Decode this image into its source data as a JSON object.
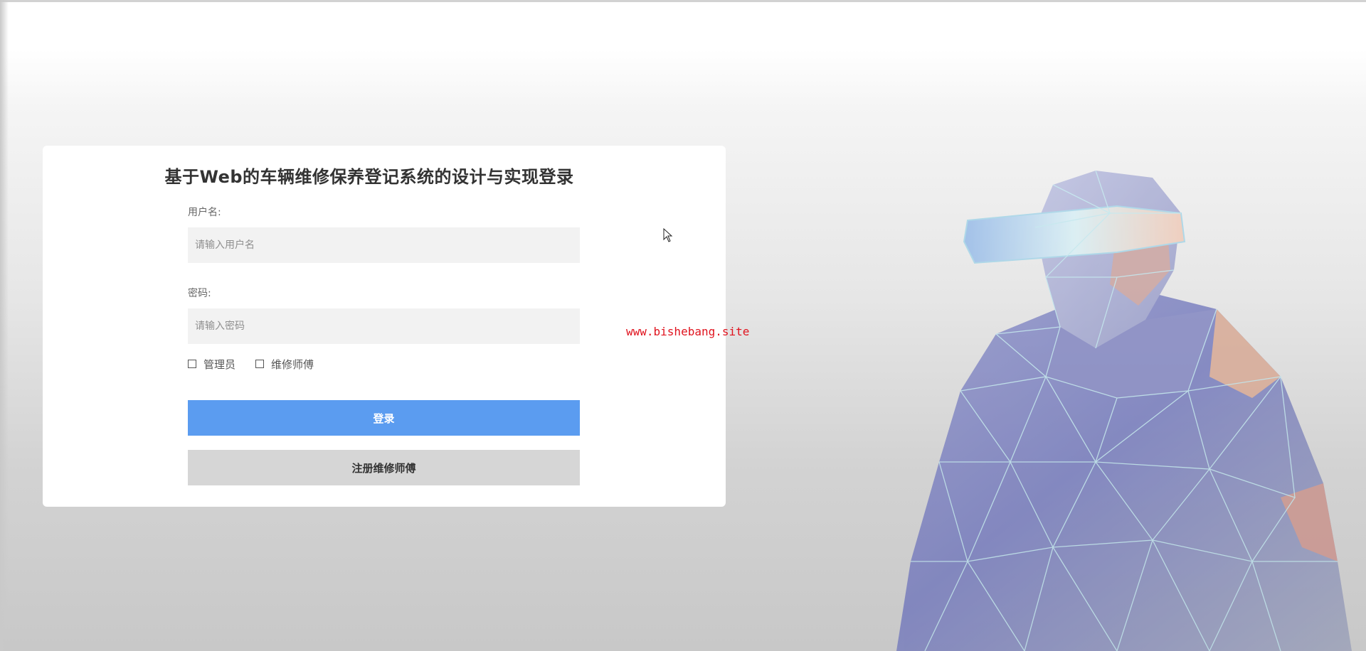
{
  "login": {
    "title": "基于Web的车辆维修保养登记系统的设计与实现登录",
    "username_label": "用户名:",
    "username_placeholder": "请输入用户名",
    "password_label": "密码:",
    "password_placeholder": "请输入密码",
    "roles": [
      {
        "label": "管理员",
        "checked": false
      },
      {
        "label": "维修师傅",
        "checked": false
      }
    ],
    "login_button": "登录",
    "register_button": "注册维修师傅"
  },
  "watermark": "www.bishebang.site",
  "colors": {
    "primary": "#5b9cf0",
    "secondary_button": "#d6d6d6",
    "watermark": "#e0131e",
    "input_bg": "#f2f2f2"
  },
  "icons": {
    "background": "low-poly-vr-figure-illustration",
    "cursor": "mouse-pointer-icon",
    "checkbox": "checkbox-unchecked-icon"
  }
}
